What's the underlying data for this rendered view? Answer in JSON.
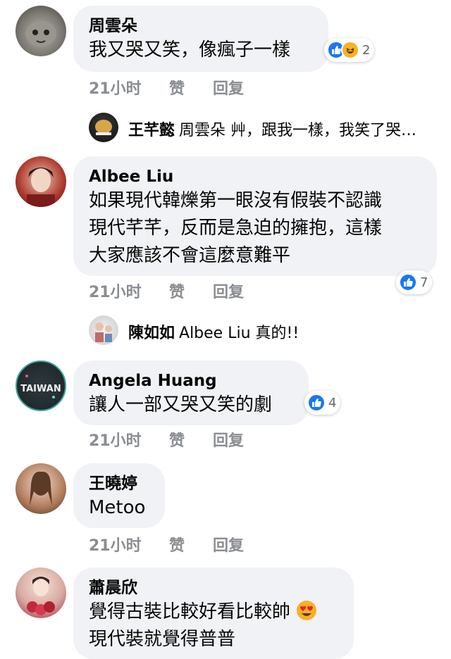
{
  "actions": {
    "time": "21小时",
    "like": "赞",
    "reply": "回复"
  },
  "colors": {
    "like_blue": "#1877f2",
    "haha_yellow": "#f7b125",
    "bubble_bg": "#f0f2f5",
    "meta_gray": "#8a8d91"
  },
  "comments": [
    {
      "name": "周雲朵",
      "lines": [
        "我又哭又笑，像瘋子一樣"
      ],
      "reaction_icons": [
        "like-icon",
        "haha-icon"
      ],
      "reaction_count": "2"
    },
    {
      "name": "Albee Liu",
      "lines": [
        "如果現代韓爍第一眼沒有假裝不認識",
        "現代芊芊，反而是急迫的擁抱，這樣",
        "大家應該不會這麼意難平"
      ],
      "reaction_icons": [
        "like-icon"
      ],
      "reaction_count": "7"
    },
    {
      "name": "Angela Huang",
      "lines": [
        "讓人一部又哭又笑的劇"
      ],
      "reaction_icons": [
        "like-icon"
      ],
      "reaction_count": "4"
    },
    {
      "name": "王曉婷",
      "lines": [
        "Metoo"
      ]
    },
    {
      "name": "蕭晨欣",
      "lines": [
        "覺得古裝比較好看比較帥",
        "現代裝就覺得普普"
      ],
      "emoji": "heart-eyes-emoji"
    }
  ],
  "replies": [
    {
      "name": "王芊懿",
      "text": "周雲朵 艸，跟我一樣，我笑了哭…"
    },
    {
      "name": "陳如如",
      "text": "Albee Liu 真的!!"
    }
  ]
}
